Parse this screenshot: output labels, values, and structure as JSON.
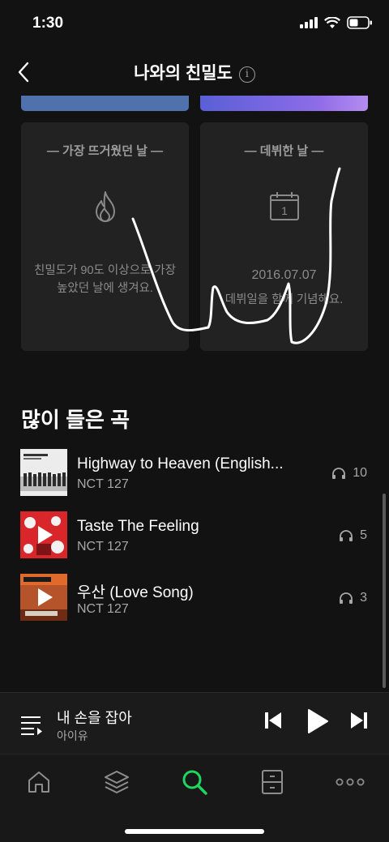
{
  "status": {
    "time": "1:30"
  },
  "header": {
    "title": "나와의 친밀도",
    "info_icon": "info-icon",
    "back_icon": "chevron-left-icon"
  },
  "colors": {
    "accent_green": "#1ed760",
    "left_strip": "#4f72ad",
    "right_strip": "#8e6ce8"
  },
  "cards": {
    "hottest_day": {
      "title": "— 가장 뜨거웠던 날 —",
      "icon": "flame-icon",
      "description": "친밀도가 90도 이상으로 가장 높았던 날에 생겨요."
    },
    "debut_day": {
      "title": "— 데뷔한 날 —",
      "icon": "calendar-icon",
      "calendar_day": "1",
      "date": "2016.07.07",
      "description": "데뷔일을 함께 기념해요."
    }
  },
  "most_played": {
    "title": "많이 들은 곡",
    "tracks": [
      {
        "title": "Highway to Heaven (English...",
        "artist": "NCT 127",
        "plays": "10",
        "playing_icon": false
      },
      {
        "title": "Taste The Feeling",
        "artist": "NCT 127",
        "plays": "5",
        "playing_icon": true
      },
      {
        "title": "우산 (Love Song)",
        "artist": "NCT 127",
        "plays": "3",
        "playing_icon": true
      }
    ]
  },
  "now_playing": {
    "title": "내 손을 잡아",
    "artist": "아이유"
  },
  "tab_bar": {
    "items": [
      {
        "name": "home",
        "icon": "home-icon"
      },
      {
        "name": "library",
        "icon": "layers-icon"
      },
      {
        "name": "search",
        "icon": "search-icon",
        "active": true
      },
      {
        "name": "storage",
        "icon": "drawer-icon"
      },
      {
        "name": "more",
        "icon": "more-icon"
      }
    ]
  }
}
